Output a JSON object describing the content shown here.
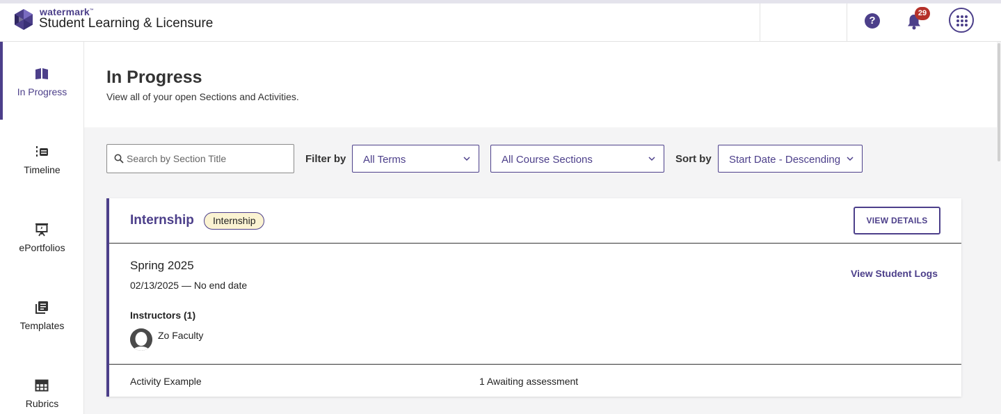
{
  "header": {
    "brand_small": "watermark",
    "brand_tm": "™",
    "app_title": "Student Learning & Licensure",
    "help_label": "?",
    "notification_count": "29"
  },
  "sidebar": {
    "items": [
      {
        "label": "In Progress",
        "icon": "open-book-icon",
        "active": true
      },
      {
        "label": "Timeline",
        "icon": "timeline-icon",
        "active": false
      },
      {
        "label": "ePortfolios",
        "icon": "presentation-board-icon",
        "active": false
      },
      {
        "label": "Templates",
        "icon": "stacked-pages-icon",
        "active": false
      },
      {
        "label": "Rubrics",
        "icon": "grid-table-icon",
        "active": false
      }
    ]
  },
  "page": {
    "title": "In Progress",
    "subtitle": "View all of your open Sections and Activities."
  },
  "filters": {
    "search_placeholder": "Search by Section Title",
    "filter_label": "Filter by",
    "terms_value": "All Terms",
    "sections_value": "All Course Sections",
    "sort_label": "Sort by",
    "sort_value": "Start Date - Descending"
  },
  "card": {
    "title": "Internship",
    "type_pill": "Internship",
    "view_details": "VIEW DETAILS",
    "term": "Spring 2025",
    "dates": "02/13/2025 — No end date",
    "student_logs": "View Student Logs",
    "instructors_heading": "Instructors (1)",
    "instructor_name": "Zo Faculty",
    "activity": {
      "name": "Activity Example",
      "status": "1 Awaiting assessment"
    }
  },
  "colors": {
    "accent": "#4c3f8a",
    "badge": "#b5312a",
    "pill_bg": "#fbf3d2",
    "page_bg": "#f4f4f5"
  }
}
